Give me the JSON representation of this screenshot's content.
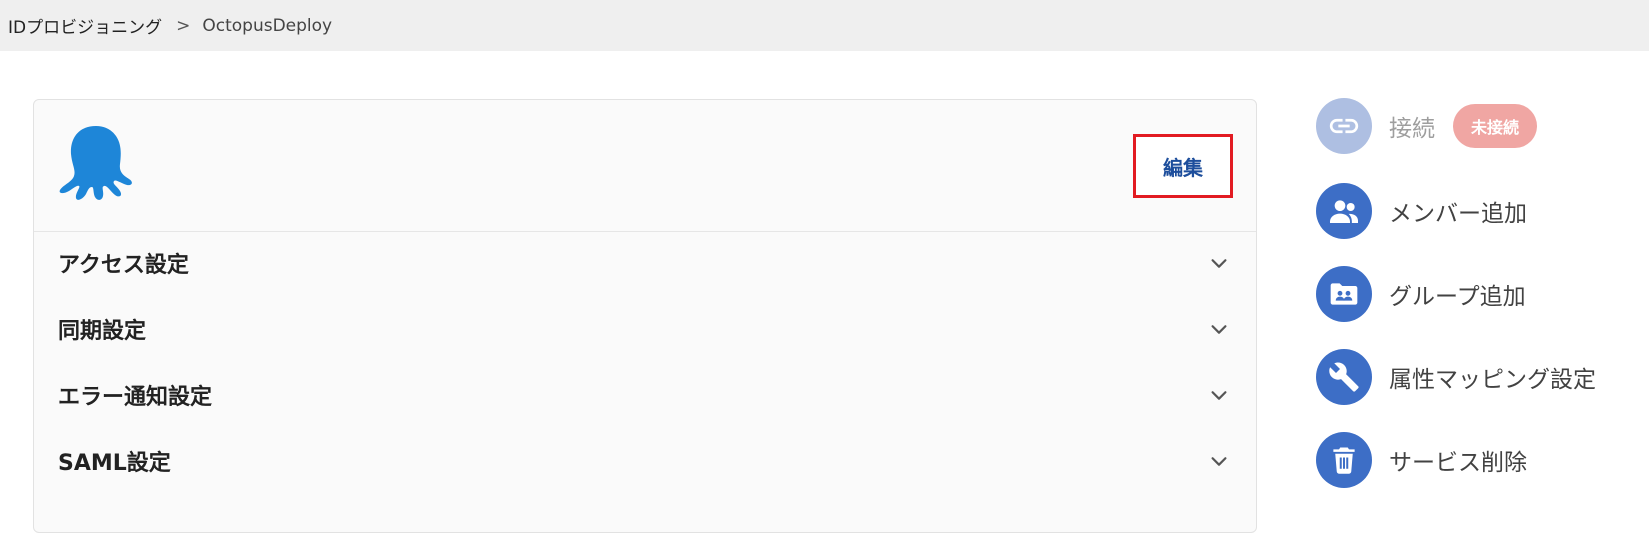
{
  "breadcrumb": {
    "parent": "IDプロビジョニング",
    "separator": ">",
    "current": "OctopusDeploy"
  },
  "card": {
    "logo_icon": "octopus-logo-icon",
    "edit_label": "編集",
    "sections": [
      {
        "title": "アクセス設定"
      },
      {
        "title": "同期設定"
      },
      {
        "title": "エラー通知設定"
      },
      {
        "title": "SAML設定"
      }
    ]
  },
  "sidebar": {
    "connection": {
      "label": "接続",
      "status": "未接続",
      "icon": "link-icon"
    },
    "actions": [
      {
        "label": "メンバー追加",
        "icon": "users-icon"
      },
      {
        "label": "グループ追加",
        "icon": "group-folder-icon"
      },
      {
        "label": "属性マッピング設定",
        "icon": "wrench-icon"
      },
      {
        "label": "サービス削除",
        "icon": "trash-icon"
      }
    ]
  },
  "colors": {
    "accent": "#3d6ec6",
    "edit_text": "#1d4e9c",
    "highlight_border": "#e21b22",
    "badge": "#f0a6a3",
    "logo": "#1e86d8"
  }
}
